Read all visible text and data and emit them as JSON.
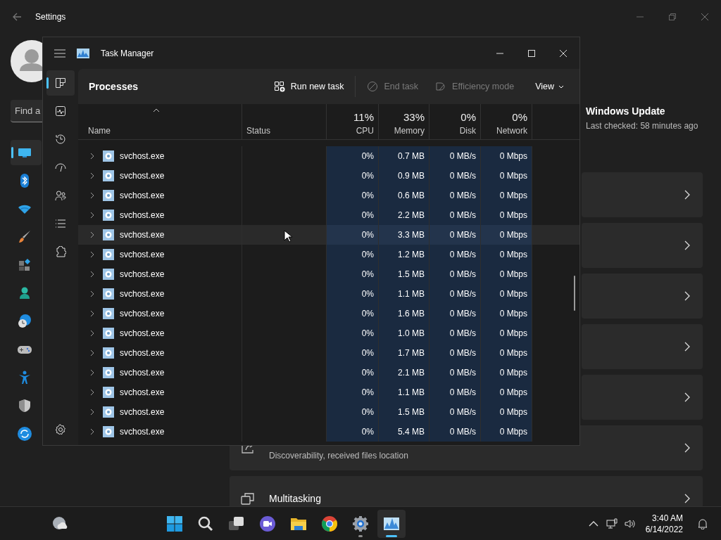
{
  "settings": {
    "title": "Settings",
    "search": {
      "placeholder": "Find a"
    },
    "nav": [
      {
        "selected": true
      },
      {
        "selected": false
      },
      {
        "selected": false
      },
      {
        "selected": false
      },
      {
        "selected": false
      },
      {
        "selected": false
      },
      {
        "selected": false
      },
      {
        "selected": false
      },
      {
        "selected": false
      },
      {
        "selected": false
      },
      {
        "selected": false
      }
    ],
    "update": {
      "title": "Windows Update",
      "subtitle": "Last checked: 58 minutes ago"
    },
    "cards": [
      {
        "kind": "covered"
      },
      {
        "kind": "covered"
      },
      {
        "kind": "covered"
      },
      {
        "kind": "covered"
      },
      {
        "kind": "covered"
      },
      {
        "kind": "full",
        "subtitle": "Discoverability, received files location"
      },
      {
        "kind": "full",
        "title": "Multitasking"
      }
    ]
  },
  "task_manager": {
    "title": "Task Manager",
    "page": "Processes",
    "rail": [
      {
        "selected": true
      },
      {
        "selected": false
      },
      {
        "selected": false
      },
      {
        "selected": false
      },
      {
        "selected": false
      },
      {
        "selected": false
      },
      {
        "selected": false
      }
    ],
    "commands": [
      {
        "kind": "action",
        "label": "Run new task",
        "disabled": false
      },
      {
        "kind": "action",
        "label": "End task",
        "disabled": true
      },
      {
        "kind": "action",
        "label": "Efficiency mode",
        "disabled": true
      },
      {
        "kind": "menu",
        "label": "View",
        "disabled": false
      }
    ],
    "columns": [
      {
        "label": "Name"
      },
      {
        "label": "Status"
      },
      {
        "usage": "11%",
        "label": "CPU"
      },
      {
        "usage": "33%",
        "label": "Memory"
      },
      {
        "usage": "0%",
        "label": "Disk"
      },
      {
        "usage": "0%",
        "label": "Network"
      }
    ],
    "rows": [
      {
        "name": "svchost.exe",
        "cpu": "0%",
        "memory": "0.7 MB",
        "disk": "0 MB/s",
        "network": "0 Mbps",
        "hovered": false
      },
      {
        "name": "svchost.exe",
        "cpu": "0%",
        "memory": "0.9 MB",
        "disk": "0 MB/s",
        "network": "0 Mbps",
        "hovered": false
      },
      {
        "name": "svchost.exe",
        "cpu": "0%",
        "memory": "0.6 MB",
        "disk": "0 MB/s",
        "network": "0 Mbps",
        "hovered": false
      },
      {
        "name": "svchost.exe",
        "cpu": "0%",
        "memory": "2.2 MB",
        "disk": "0 MB/s",
        "network": "0 Mbps",
        "hovered": false
      },
      {
        "name": "svchost.exe",
        "cpu": "0%",
        "memory": "3.3 MB",
        "disk": "0 MB/s",
        "network": "0 Mbps",
        "hovered": true
      },
      {
        "name": "svchost.exe",
        "cpu": "0%",
        "memory": "1.2 MB",
        "disk": "0 MB/s",
        "network": "0 Mbps",
        "hovered": false
      },
      {
        "name": "svchost.exe",
        "cpu": "0%",
        "memory": "1.5 MB",
        "disk": "0 MB/s",
        "network": "0 Mbps",
        "hovered": false
      },
      {
        "name": "svchost.exe",
        "cpu": "0%",
        "memory": "1.1 MB",
        "disk": "0 MB/s",
        "network": "0 Mbps",
        "hovered": false
      },
      {
        "name": "svchost.exe",
        "cpu": "0%",
        "memory": "1.6 MB",
        "disk": "0 MB/s",
        "network": "0 Mbps",
        "hovered": false
      },
      {
        "name": "svchost.exe",
        "cpu": "0%",
        "memory": "1.0 MB",
        "disk": "0 MB/s",
        "network": "0 Mbps",
        "hovered": false
      },
      {
        "name": "svchost.exe",
        "cpu": "0%",
        "memory": "1.7 MB",
        "disk": "0 MB/s",
        "network": "0 Mbps",
        "hovered": false
      },
      {
        "name": "svchost.exe",
        "cpu": "0%",
        "memory": "2.1 MB",
        "disk": "0 MB/s",
        "network": "0 Mbps",
        "hovered": false
      },
      {
        "name": "svchost.exe",
        "cpu": "0%",
        "memory": "1.1 MB",
        "disk": "0 MB/s",
        "network": "0 Mbps",
        "hovered": false
      },
      {
        "name": "svchost.exe",
        "cpu": "0%",
        "memory": "1.5 MB",
        "disk": "0 MB/s",
        "network": "0 Mbps",
        "hovered": false
      },
      {
        "name": "svchost.exe",
        "cpu": "0%",
        "memory": "5.4 MB",
        "disk": "0 MB/s",
        "network": "0 Mbps",
        "hovered": false
      }
    ]
  },
  "taskbar": {
    "apps": [
      {
        "running": false,
        "active": false
      },
      {
        "running": false,
        "active": false
      },
      {
        "running": false,
        "active": false
      },
      {
        "running": false,
        "active": false
      },
      {
        "running": false,
        "active": false
      },
      {
        "running": false,
        "active": false
      },
      {
        "running": true,
        "active": false
      },
      {
        "running": true,
        "active": true
      }
    ],
    "time": "3:40 AM",
    "date": "6/14/2022"
  }
}
